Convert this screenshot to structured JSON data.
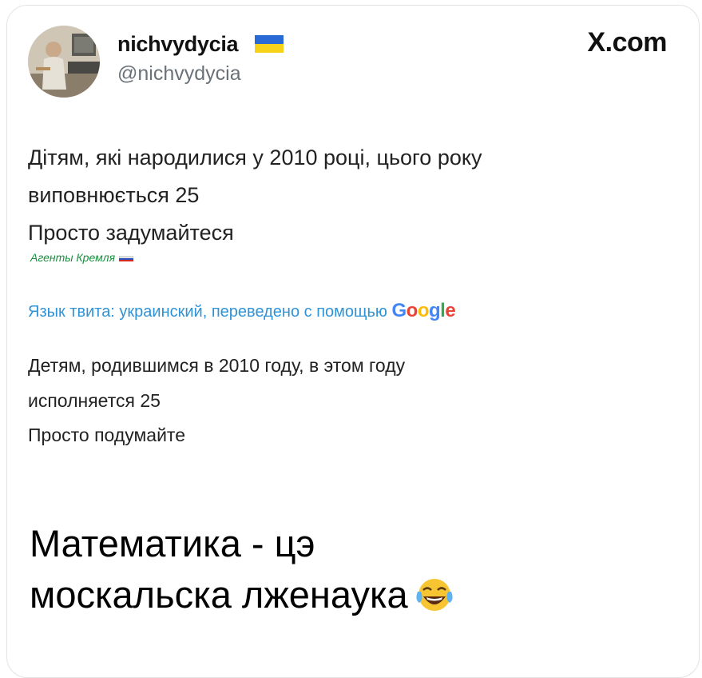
{
  "header": {
    "display_name": "nichvydycia",
    "handle": "@nichvydycia",
    "brand": "X.com"
  },
  "tweet": {
    "lines": [
      "Дітям, які народилися у 2010 році, цього року",
      "виповнюється 25",
      "Просто задумайтеся"
    ]
  },
  "watermark": "Агенты Кремля",
  "translation": {
    "label": "Язык твита: украинский, переведено с помощью",
    "brand": "Google",
    "lines": [
      "Детям, родившимся в 2010 году, в этом году",
      "исполняется 25",
      "Просто подумайте"
    ]
  },
  "caption": {
    "line1": "Математика - цэ",
    "line2": "москальска лженаука"
  },
  "colors": {
    "link": "#2f93d6",
    "watermark": "#1a8f3d",
    "flag_blue": "#2a6ad7",
    "flag_yellow": "#f6d21a"
  },
  "icons": {
    "flag": "ukraine-flag-icon",
    "emoji": "face-with-tears-of-joy-icon"
  }
}
